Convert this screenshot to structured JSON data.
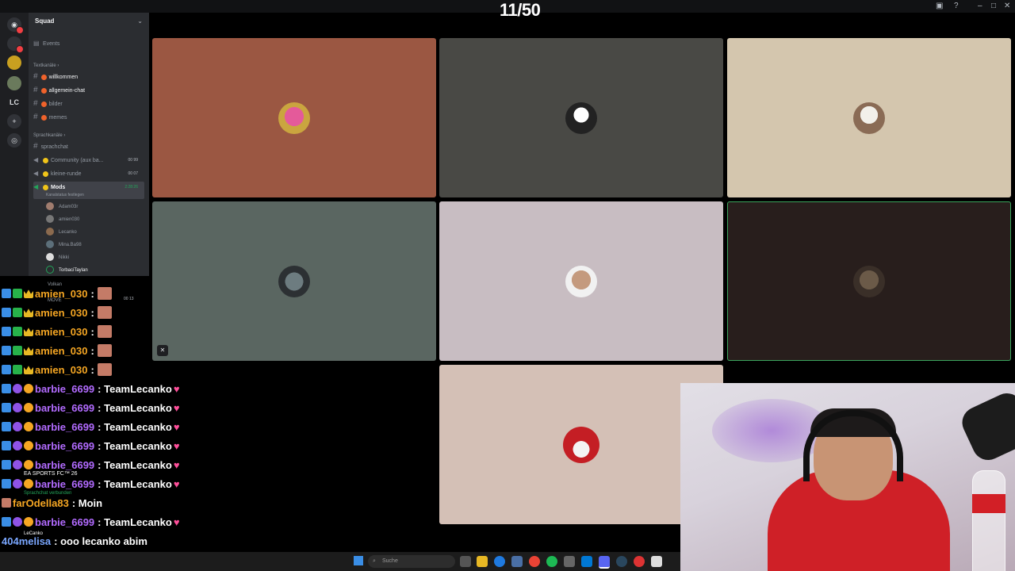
{
  "counter": "11/50",
  "server": {
    "name": "Squad",
    "events": "Events",
    "rail_text": "LC"
  },
  "text_category": "Textkanäle",
  "text_channels": [
    "willkommen",
    "allgemein-chat",
    "bilder",
    "memes"
  ],
  "voice_category": "Sprachkanäle",
  "voice_channels": [
    {
      "name": "sprachchat",
      "count": ""
    },
    {
      "name": "Community (aux ba...",
      "count": "00 99"
    },
    {
      "name": "kleine-runde",
      "count": "00 07"
    },
    {
      "name": "Mods",
      "count": "2:28:26",
      "status": "Kanalstatus festlegen"
    }
  ],
  "members": [
    "Adam03r",
    "amien030",
    "Lecanko",
    "Mina.Ba98",
    "Nikki",
    "TorbaciTaylan",
    "Volkan"
  ],
  "move_label": "MOVE",
  "move_count": "00 13",
  "tiles": [
    {
      "bg": "#9b5742"
    },
    {
      "bg": "#494945"
    },
    {
      "bg": "#d4c6ae"
    },
    {
      "bg": "#5a6661"
    },
    {
      "bg": "#c8bdc2"
    },
    {
      "bg": "#281e1c"
    },
    {
      "bg": "#d4c0b6"
    }
  ],
  "chat": [
    {
      "user": "amien_030",
      "text": ":",
      "kind": "amien"
    },
    {
      "user": "amien_030",
      "text": ":",
      "kind": "amien"
    },
    {
      "user": "amien_030",
      "text": ":",
      "kind": "amien"
    },
    {
      "user": "amien_030",
      "text": ":",
      "kind": "amien"
    },
    {
      "user": "amien_030",
      "text": ":",
      "kind": "amien"
    },
    {
      "user": "barbie_6699",
      "text": ": TeamLecanko",
      "kind": "barbie"
    },
    {
      "user": "barbie_6699",
      "text": ": TeamLecanko",
      "kind": "barbie"
    },
    {
      "user": "barbie_6699",
      "text": ": TeamLecanko",
      "kind": "barbie"
    },
    {
      "user": "barbie_6699",
      "text": ": TeamLecanko",
      "kind": "barbie"
    },
    {
      "user": "barbie_6699",
      "text": ": TeamLecanko",
      "kind": "barbie"
    },
    {
      "user": "barbie_6699",
      "text": ": TeamLecanko",
      "kind": "barbie"
    },
    {
      "user": "farOdella83",
      "text": ": Moin",
      "kind": "far"
    },
    {
      "user": "barbie_6699",
      "text": ": TeamLecanko",
      "kind": "barbie"
    },
    {
      "user": "404melisa",
      "text": ": ooo lecanko abim",
      "kind": "melisa"
    },
    {
      "user": "barbie_6699",
      "text": ": TeamLecanko",
      "kind": "barbie"
    }
  ],
  "game": "EA SPORTS FC™ 26",
  "voice_connected": "Sprachchat verbunden",
  "current_user": "LeCanko",
  "taskbar": {
    "search_placeholder": "Suche"
  }
}
